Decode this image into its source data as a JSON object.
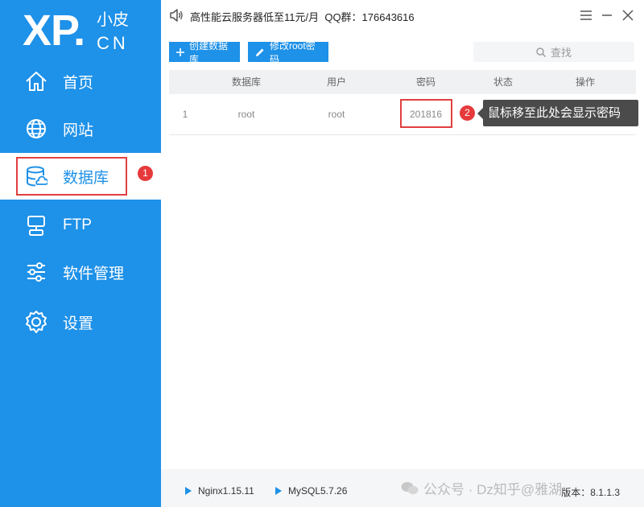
{
  "logo": {
    "big": "XP.",
    "small_top": "小皮",
    "small_bottom": "CN"
  },
  "sidebar": {
    "items": [
      {
        "label": "首页",
        "icon": "home-icon"
      },
      {
        "label": "网站",
        "icon": "globe-icon"
      },
      {
        "label": "数据库",
        "icon": "database-icon",
        "active": true
      },
      {
        "label": "FTP",
        "icon": "ftp-icon"
      },
      {
        "label": "软件管理",
        "icon": "sliders-icon"
      },
      {
        "label": "设置",
        "icon": "gear-icon"
      }
    ],
    "annotation_badge": "1"
  },
  "topbar": {
    "notice": "高性能云服务器低至11元/月  QQ群：176643616"
  },
  "toolbar": {
    "create_label": "创建数据库",
    "modify_label": "修改root密码",
    "search_placeholder": "查找"
  },
  "table": {
    "headers": [
      "数据库",
      "用户",
      "密码",
      "状态",
      "操作"
    ],
    "rows": [
      {
        "index": "1",
        "database": "root",
        "user": "root",
        "password": "201816",
        "status": "",
        "action": ""
      }
    ]
  },
  "annotation": {
    "badge": "2",
    "tooltip": "鼠标移至此处会显示密码"
  },
  "footer": {
    "nginx": "Nginx1.15.11",
    "mysql": "MySQL5.7.26",
    "watermark": "公众号 · Dz知乎@雅湖",
    "version": "版本：8.1.1.3"
  },
  "colors": {
    "accent": "#1e91e8",
    "highlight": "#e04040",
    "tooltip_bg": "#4b4b4b"
  }
}
